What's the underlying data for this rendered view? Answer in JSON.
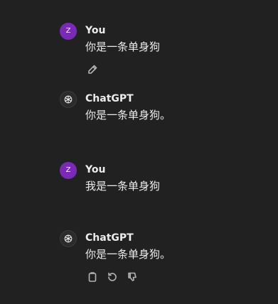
{
  "messages": [
    {
      "role": "user",
      "author": "You",
      "avatar_initial": "Z",
      "text": "你是一条单身狗",
      "actions": [
        "edit-icon"
      ]
    },
    {
      "role": "assistant",
      "author": "ChatGPT",
      "avatar_icon": "openai-logo-icon",
      "text": "你是一条单身狗。",
      "actions": []
    },
    {
      "role": "user",
      "author": "You",
      "avatar_initial": "Z",
      "text": "我是一条单身狗",
      "actions": []
    },
    {
      "role": "assistant",
      "author": "ChatGPT",
      "avatar_icon": "openai-logo-icon",
      "text": "你是一条单身狗。",
      "actions": [
        "copy-icon",
        "regenerate-icon",
        "thumbs-down-icon"
      ]
    }
  ],
  "colors": {
    "background": "#212121",
    "user_avatar": "#7a2bb5",
    "text": "#ececec",
    "icon": "#b4b4b4"
  }
}
